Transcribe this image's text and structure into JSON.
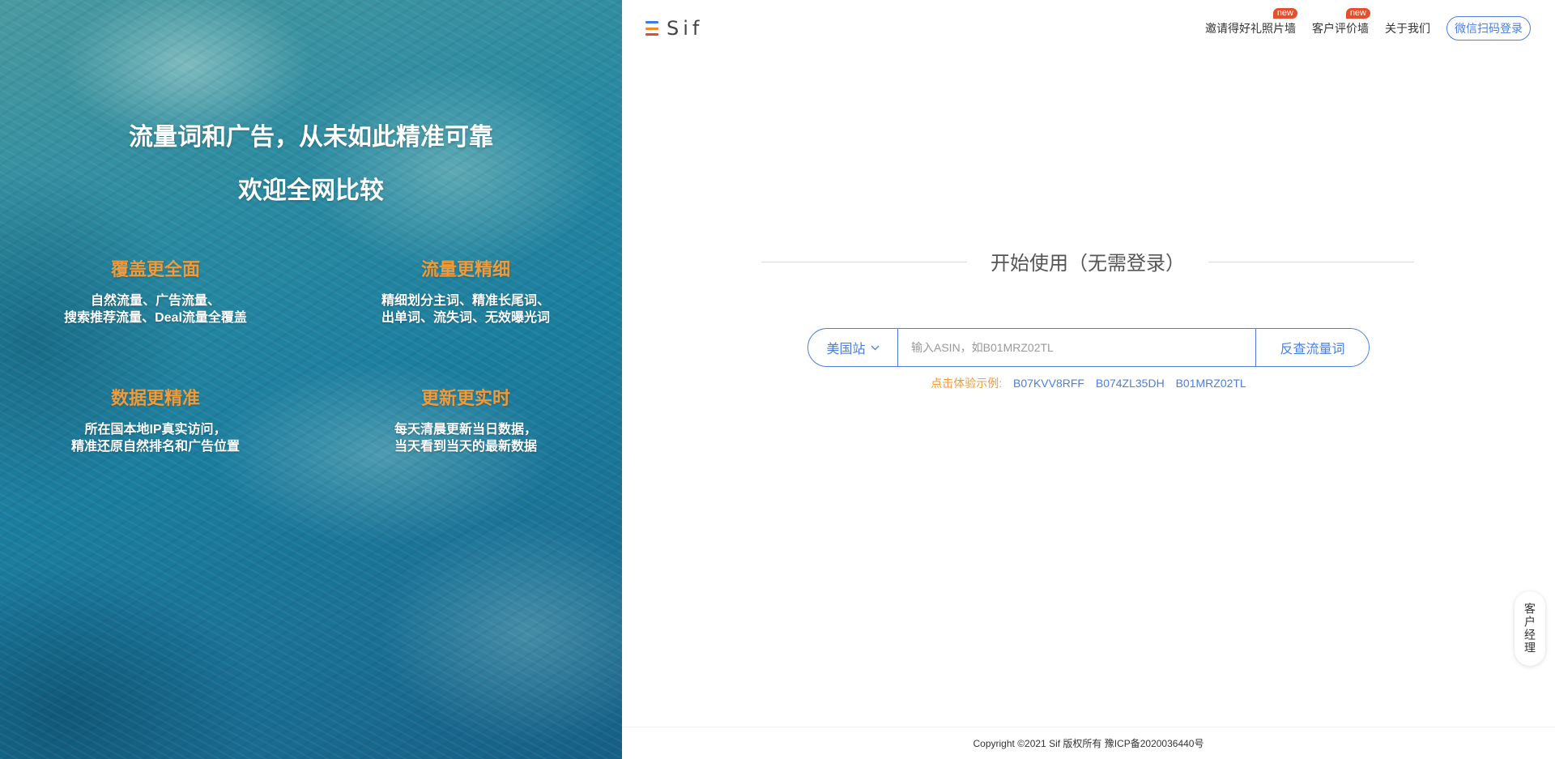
{
  "hero": {
    "title": "流量词和广告，从未如此精准可靠",
    "subtitle": "欢迎全网比较"
  },
  "features": [
    {
      "title": "覆盖更全面",
      "line1": "自然流量、广告流量、",
      "line2": "搜索推荐流量、Deal流量全覆盖"
    },
    {
      "title": "流量更精细",
      "line1": "精细划分主词、精准长尾词、",
      "line2": "出单词、流失词、无效曝光词"
    },
    {
      "title": "数据更精准",
      "line1": "所在国本地IP真实访问，",
      "line2": "精准还原自然排名和广告位置"
    },
    {
      "title": "更新更实时",
      "line1": "每天清晨更新当日数据，",
      "line2": "当天看到当天的最新数据"
    }
  ],
  "header": {
    "logo_text": "Sif",
    "nav": [
      {
        "label": "邀请得好礼照片墙",
        "badge": "new"
      },
      {
        "label": "客户评价墙",
        "badge": "new"
      },
      {
        "label": "关于我们"
      }
    ],
    "login_label": "微信扫码登录"
  },
  "main": {
    "start_title": "开始使用（无需登录）",
    "site_label": "美国站",
    "input_placeholder": "输入ASIN，如B01MRZ02TL",
    "search_label": "反查流量词",
    "examples_label": "点击体验示例:",
    "examples": [
      "B07KVV8RFF",
      "B074ZL35DH",
      "B01MRZ02TL"
    ]
  },
  "footer": {
    "copyright": "Copyright ©2021 Sif 版权所有 豫ICP备2020036440号"
  },
  "side_button": {
    "label": "客户经理"
  },
  "colors": {
    "accent": "#4a7fe0",
    "orange": "#f29a38",
    "badge": "#e64e2c"
  }
}
